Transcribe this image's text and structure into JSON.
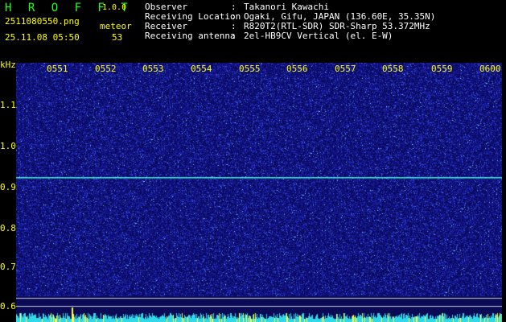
{
  "app": {
    "name": "H R O F F T",
    "version": "1.0.0"
  },
  "file": {
    "name": "2511080550.png",
    "datetime": "25.11.08 05:50"
  },
  "meteor": {
    "label": "meteor",
    "count": "53"
  },
  "info": [
    {
      "key": "Observer",
      "value": "Takanori Kawachi"
    },
    {
      "key": "Receiving Location",
      "value": "Ogaki, Gifu, JAPAN (136.60E, 35.35N)"
    },
    {
      "key": "Receiver",
      "value": "R820T2(RTL-SDR) SDR-Sharp 53.372MHz"
    },
    {
      "key": "Receiving antenna",
      "value": "2el-HB9CV Vertical (el. E-W)"
    }
  ],
  "axis": {
    "unit": "kHz",
    "y_ticks": [
      "1.1",
      "1.0",
      "0.9",
      "0.8",
      "0.7",
      "0.6"
    ],
    "x_ticks": [
      "0551",
      "0552",
      "0553",
      "0554",
      "0555",
      "0556",
      "0557",
      "0558",
      "0559",
      "0600"
    ]
  },
  "colors": {
    "background": "#000000",
    "label": "#ffff00",
    "title": "#22ff22",
    "spectrum": "#14147a",
    "carrier": "#40e8d0"
  }
}
